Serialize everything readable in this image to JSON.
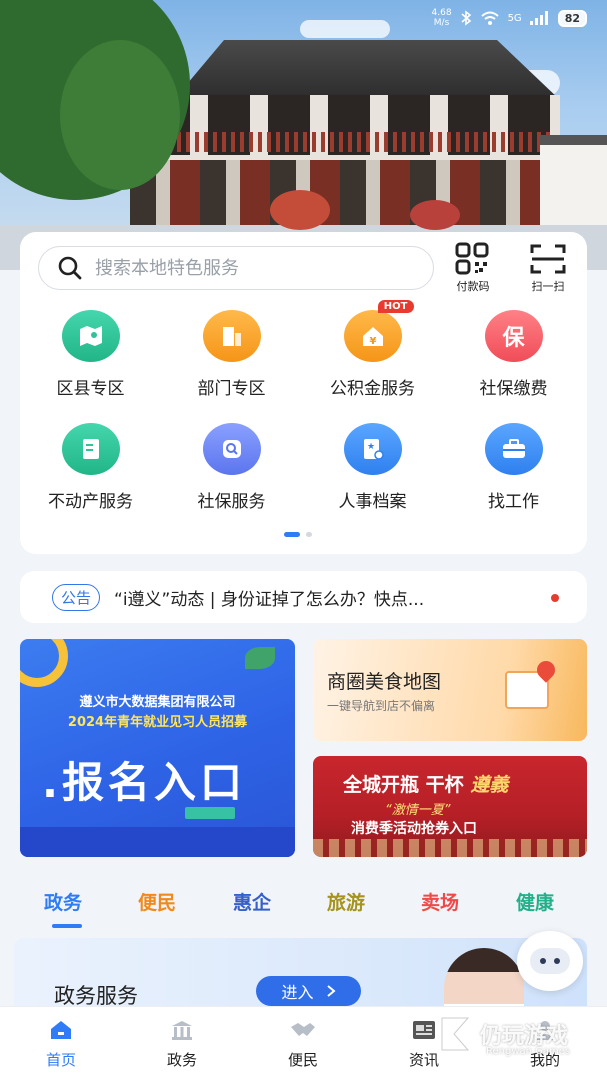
{
  "status_bar": {
    "speed_value": "4.68",
    "speed_unit": "M/s",
    "network": "5G",
    "battery": "82"
  },
  "search": {
    "placeholder": "搜索本地特色服务"
  },
  "quick_actions": {
    "pay_code": "付款码",
    "scan": "扫一扫"
  },
  "services": [
    {
      "label": "区县专区",
      "icon": "map-icon",
      "color": "#2fc39a"
    },
    {
      "label": "部门专区",
      "icon": "building-icon",
      "color": "#f7a12a"
    },
    {
      "label": "公积金服务",
      "icon": "house-money-icon",
      "color": "#f7a12a",
      "badge": "HOT"
    },
    {
      "label": "社保缴费",
      "icon": "bao-icon",
      "color": "#f35f66",
      "glyph": "保"
    },
    {
      "label": "不动产服务",
      "icon": "document-icon",
      "color": "#2fc39a"
    },
    {
      "label": "社保服务",
      "icon": "search-shield-icon",
      "color": "#5b7cf2"
    },
    {
      "label": "人事档案",
      "icon": "file-star-icon",
      "color": "#3c8df2"
    },
    {
      "label": "找工作",
      "icon": "briefcase-icon",
      "color": "#3c8df2"
    }
  ],
  "notice": {
    "tag": "公告",
    "text": "“i遵义”动态 | 身份证掉了怎么办？快点..."
  },
  "banners": {
    "recruit_line1": "遵义市大数据集团有限公司",
    "recruit_line2": "2024年青年就业见习人员招募",
    "recruit_cta": ".报名入口",
    "food_title": "商圈美食地图",
    "food_sub": "一键导航到店不偏离",
    "promo_line1_a": "全城开瓶 干杯 ",
    "promo_line1_b": "遵義",
    "promo_line2": "“激情一夏”",
    "promo_line3": "消费季活动抢券入口"
  },
  "category_tabs": [
    {
      "label": "政务",
      "color": "#2f7cf6"
    },
    {
      "label": "便民",
      "color": "#f08a1c"
    },
    {
      "label": "惠企",
      "color": "#3560c9"
    },
    {
      "label": "旅游",
      "color": "#a4931e"
    },
    {
      "label": "卖场",
      "color": "#ef4a4a"
    },
    {
      "label": "健康",
      "color": "#22b08a"
    }
  ],
  "gov_panel": {
    "title": "政务服务",
    "enter": "进入"
  },
  "bottom_nav": [
    {
      "label": "首页",
      "icon": "home-icon",
      "active": true
    },
    {
      "label": "政务",
      "icon": "institution-icon",
      "active": false
    },
    {
      "label": "便民",
      "icon": "handshake-icon",
      "active": false
    },
    {
      "label": "资讯",
      "icon": "news-icon",
      "active": false
    },
    {
      "label": "我的",
      "icon": "user-icon",
      "active": false
    }
  ],
  "watermark": {
    "brand": "仍玩游戏",
    "url": "Rengwan Games"
  }
}
